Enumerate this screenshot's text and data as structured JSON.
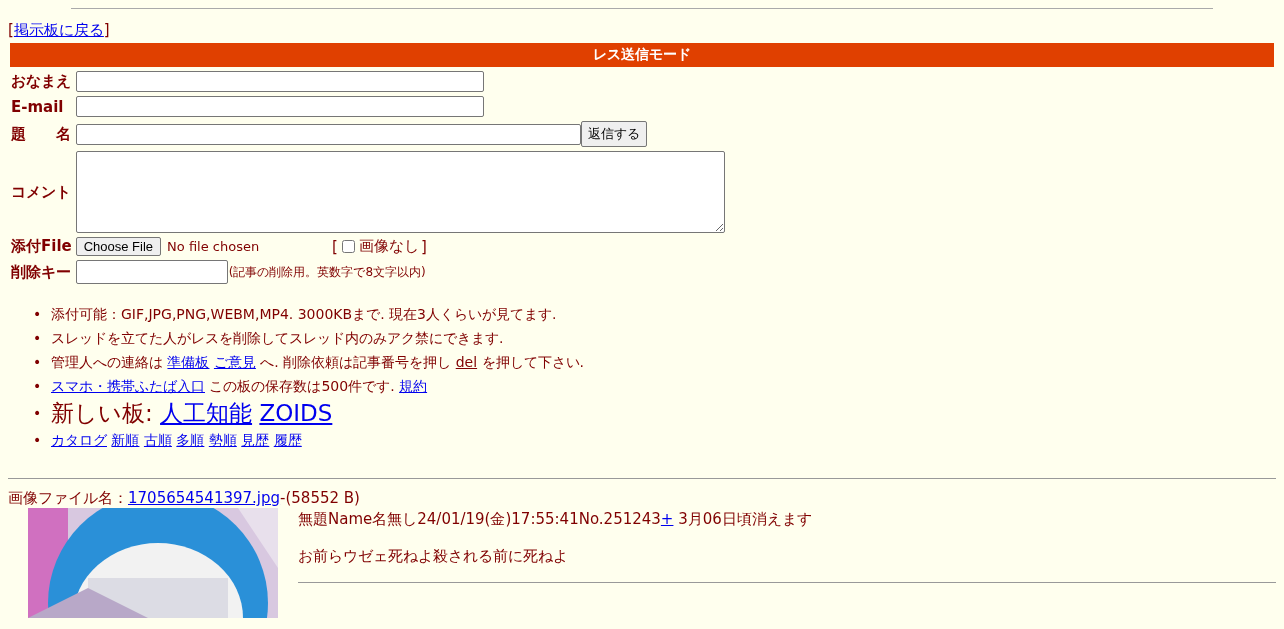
{
  "back_link": {
    "open": "[",
    "text": "掲示板に戻る",
    "close": "]"
  },
  "form": {
    "title": "レス送信モード",
    "rows": [
      {
        "label": "おなまえ",
        "kind": "text"
      },
      {
        "label": "E-mail",
        "kind": "text"
      },
      {
        "label": "題　　名",
        "kind": "subject",
        "button": "返信する"
      },
      {
        "label": "コメント",
        "kind": "textarea"
      },
      {
        "label": "添付File",
        "kind": "file",
        "button": "Choose File",
        "status": "No file chosen",
        "checkbox": {
          "open": "[",
          "label": "画像なし",
          "checked": false,
          "close": "]"
        }
      },
      {
        "label": "削除キー",
        "kind": "password",
        "note": "(記事の削除用。英数字で8文字以内)"
      }
    ]
  },
  "notices": [
    {
      "marker": "•",
      "large": false,
      "parts": [
        {
          "kind": "text",
          "text": "添付可能：GIF,JPG,PNG,WEBM,MP4. 3000KBまで. 現在3人くらいが見てます."
        }
      ]
    },
    {
      "marker": "•",
      "large": false,
      "parts": [
        {
          "kind": "text",
          "text": "スレッドを立てた人がレスを削除してスレッド内のみアク禁にできます."
        }
      ]
    },
    {
      "marker": "•",
      "large": false,
      "parts": [
        {
          "kind": "text",
          "text": "管理人への連絡は"
        },
        {
          "kind": "link",
          "text": "準備板"
        },
        {
          "kind": "link",
          "text": "ご意見"
        },
        {
          "kind": "text",
          "text": "へ. 削除依頼は記事番号を押し"
        },
        {
          "kind": "underline",
          "text": "del"
        },
        {
          "kind": "text",
          "text": "を押して下さい."
        }
      ]
    },
    {
      "marker": "•",
      "large": false,
      "parts": [
        {
          "kind": "link",
          "text": "スマホ・携帯ふたば入口"
        },
        {
          "kind": "text",
          "text": "この板の保存数は500件です."
        },
        {
          "kind": "link",
          "text": "規約"
        }
      ]
    },
    {
      "marker": "•",
      "large": true,
      "parts": [
        {
          "kind": "text",
          "text": "新しい板:"
        },
        {
          "kind": "link",
          "text": "人工知能"
        },
        {
          "kind": "link",
          "text": "ZOIDS"
        }
      ]
    },
    {
      "marker": "•",
      "large": false,
      "parts": [
        {
          "kind": "link",
          "text": "カタログ"
        },
        {
          "kind": "link",
          "text": "新順"
        },
        {
          "kind": "link",
          "text": "古順"
        },
        {
          "kind": "link",
          "text": "多順"
        },
        {
          "kind": "link",
          "text": "勢順"
        },
        {
          "kind": "link",
          "text": "見歴"
        },
        {
          "kind": "link",
          "text": "履歴"
        }
      ]
    }
  ],
  "post": {
    "file_label": "画像ファイル名：",
    "file_link": "1705654541397.jpg",
    "file_size": "-(58552 B)",
    "header": "無題Name名無し24/01/19(金)17:55:41No.251243",
    "plus_link": "+",
    "expiry": "3月06日頃消えます",
    "comment": "お前らウゼェ死ねよ殺される前に死ねよ"
  }
}
